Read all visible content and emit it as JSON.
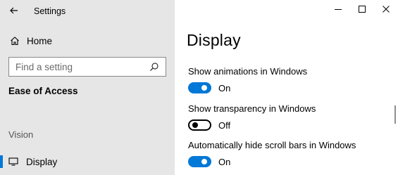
{
  "window": {
    "title": "Settings",
    "controls": {
      "minimize_icon": "minimize-icon",
      "maximize_icon": "maximize-icon",
      "close_icon": "close-icon"
    }
  },
  "sidebar": {
    "home_label": "Home",
    "search_placeholder": "Find a setting",
    "section_heading": "Ease of Access",
    "group_label": "Vision",
    "items": [
      {
        "label": "Display",
        "icon": "monitor-icon",
        "selected": true
      }
    ]
  },
  "main": {
    "title": "Display",
    "settings": [
      {
        "title": "Show animations in Windows",
        "state_label": "On",
        "on": true
      },
      {
        "title": "Show transparency in Windows",
        "state_label": "Off",
        "on": false
      },
      {
        "title": "Automatically hide scroll bars in Windows",
        "state_label": "On",
        "on": true
      }
    ]
  },
  "colors": {
    "accent": "#0078d7",
    "sidebar_bg": "#e6e6e6",
    "content_bg": "#ffffff"
  }
}
